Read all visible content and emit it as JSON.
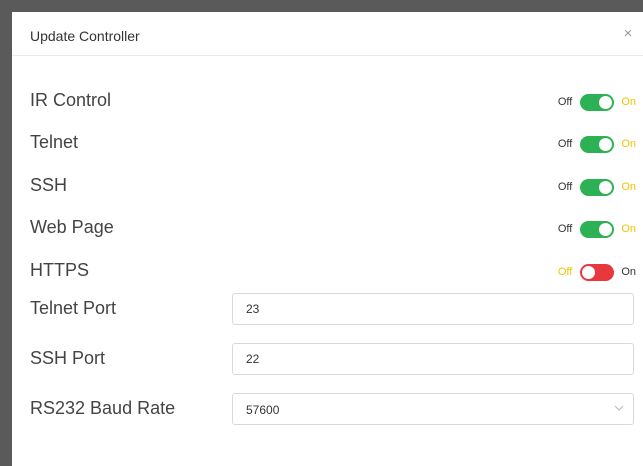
{
  "dialog": {
    "title": "Update Controller",
    "close_glyph": "×"
  },
  "toggles": [
    {
      "label": "IR Control",
      "off_label": "Off",
      "on_label": "On",
      "state": "on"
    },
    {
      "label": "Telnet",
      "off_label": "Off",
      "on_label": "On",
      "state": "on"
    },
    {
      "label": "SSH",
      "off_label": "Off",
      "on_label": "On",
      "state": "on"
    },
    {
      "label": "Web Page",
      "off_label": "Off",
      "on_label": "On",
      "state": "on"
    },
    {
      "label": "HTTPS",
      "off_label": "Off",
      "on_label": "On",
      "state": "off"
    }
  ],
  "fields": {
    "telnet_port": {
      "label": "Telnet Port",
      "value": "23"
    },
    "ssh_port": {
      "label": "SSH Port",
      "value": "22"
    },
    "baud_rate": {
      "label": "RS232 Baud Rate",
      "value": "57600"
    }
  },
  "colors": {
    "switch_on": "#2db155",
    "switch_off": "#e8383d",
    "active_label": "#f2c200"
  },
  "icons": {
    "close": "close-icon",
    "dropdown": "chevron-down-icon"
  }
}
